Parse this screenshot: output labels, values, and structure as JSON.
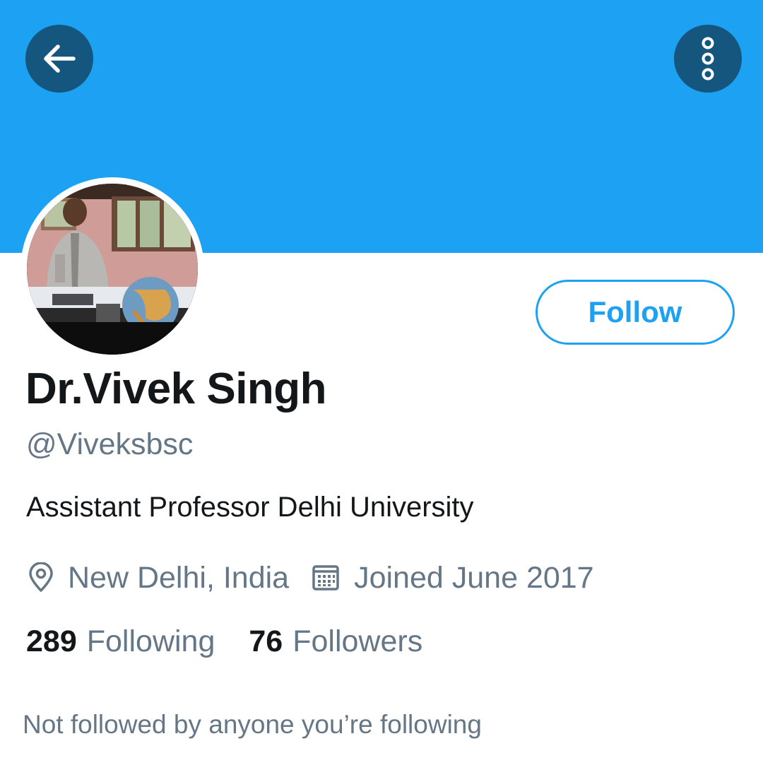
{
  "header": {
    "back_icon": "arrow-left-icon",
    "more_icon": "more-vertical-icon",
    "banner_color": "#1da1f2",
    "button_bg": "#15567f"
  },
  "profile": {
    "display_name": "Dr.Vivek Singh",
    "handle": "@Viveksbsc",
    "bio": "Assistant Professor Delhi University",
    "location": "New Delhi, India",
    "location_icon": "location-pin-icon",
    "joined": "Joined June 2017",
    "joined_icon": "calendar-icon",
    "follow_label": "Follow",
    "avatar": "profile-photo"
  },
  "stats": {
    "following_count": "289",
    "following_label": "Following",
    "followers_count": "76",
    "followers_label": "Followers"
  },
  "social_context": "Not followed by anyone you’re following",
  "colors": {
    "accent": "#1da1f2",
    "text_primary": "#14171a",
    "text_secondary": "#657786"
  }
}
